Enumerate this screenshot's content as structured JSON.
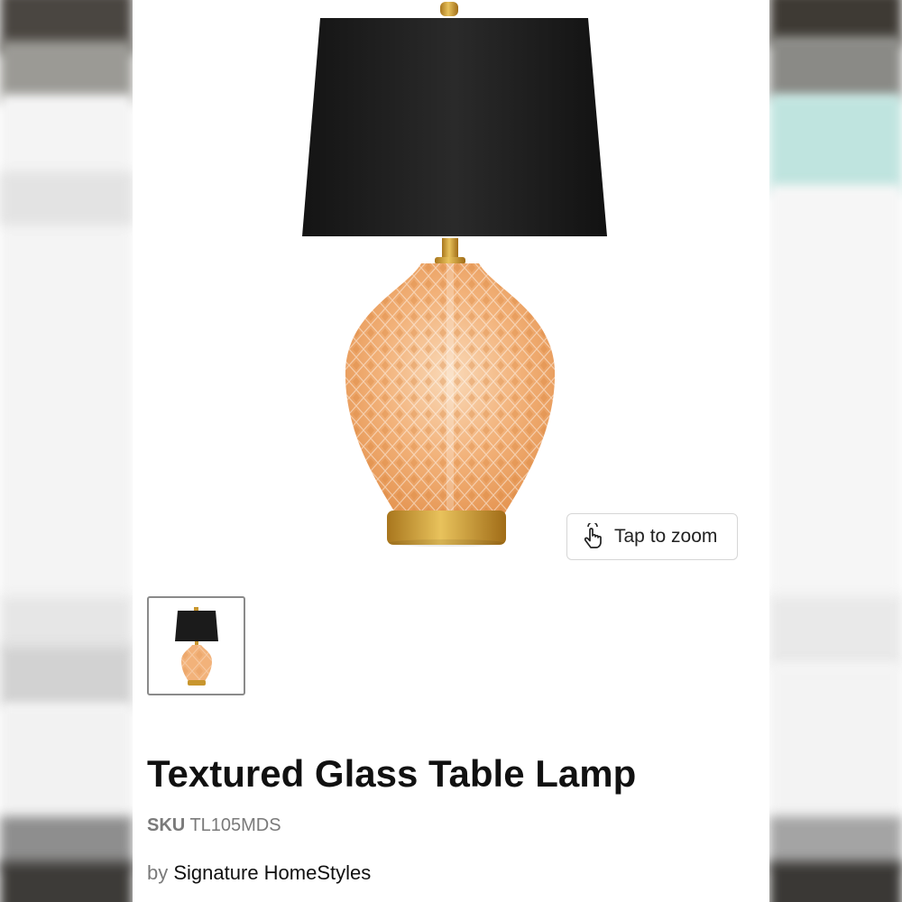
{
  "product": {
    "title": "Textured Glass Table Lamp",
    "sku_label": "SKU",
    "sku_value": "TL105MDS",
    "by_label": "by",
    "brand": "Signature HomeStyles"
  },
  "gallery": {
    "zoom_label": "Tap to zoom",
    "zoom_icon": "tap-hand-icon",
    "image_count": 1,
    "selected_index": 0
  },
  "colors": {
    "shade": "#1b1b1b",
    "glass": "#f2b27a",
    "brass": "#c8962e"
  }
}
